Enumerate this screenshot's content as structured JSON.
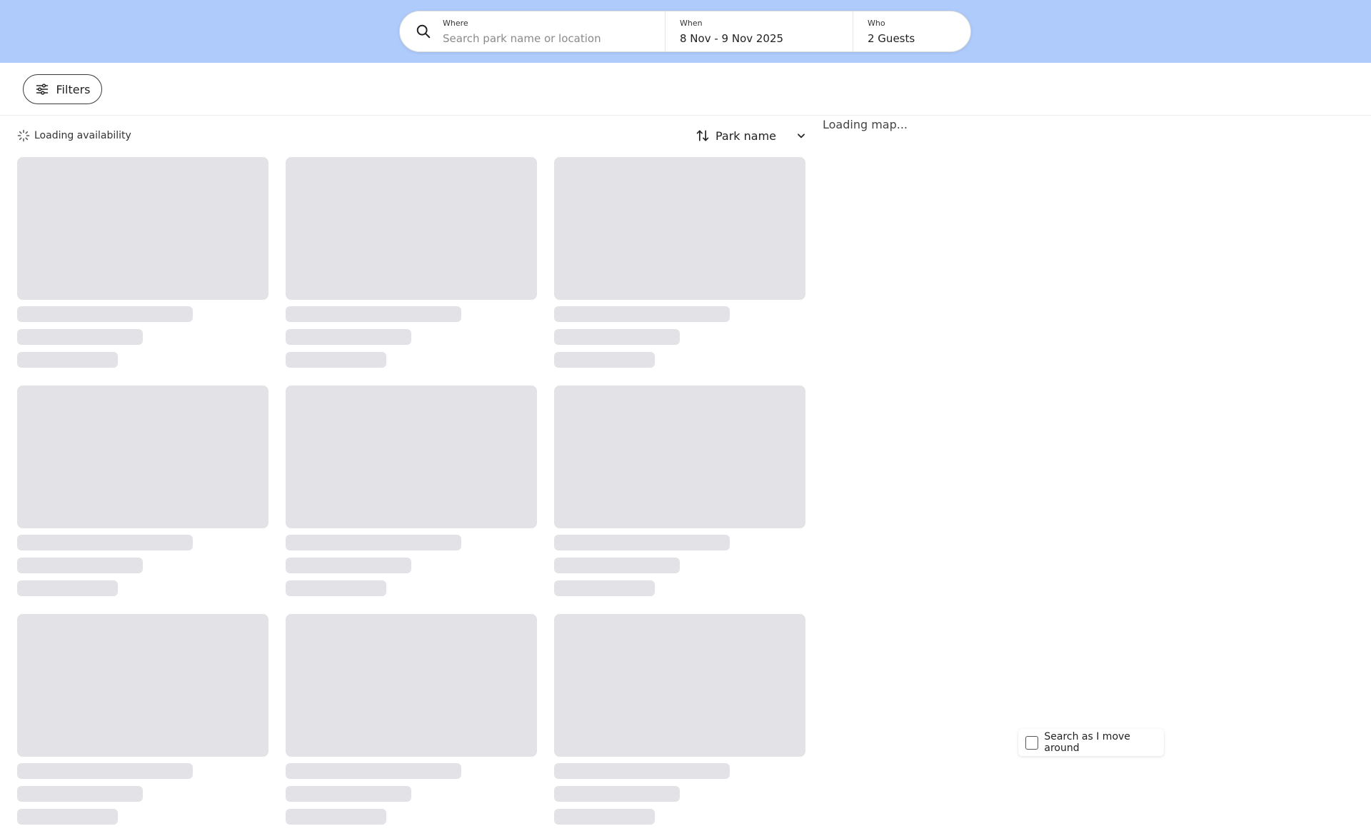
{
  "search": {
    "where_label": "Where",
    "where_placeholder": "Search park name or location",
    "when_label": "When",
    "when_value": "8 Nov - 9 Nov 2025",
    "who_label": "Who",
    "who_value": "2 Guests"
  },
  "filters": {
    "label": "Filters"
  },
  "results": {
    "loading_text": "Loading availability",
    "sort_label": "Park name",
    "skeleton_cards": 9
  },
  "map": {
    "loading_text": "Loading map...",
    "search_as_move_label": "Search as I move around",
    "search_as_move_checked": false
  },
  "colors": {
    "header_bg": "#aecbfc",
    "skeleton": "#e2e2e7"
  }
}
